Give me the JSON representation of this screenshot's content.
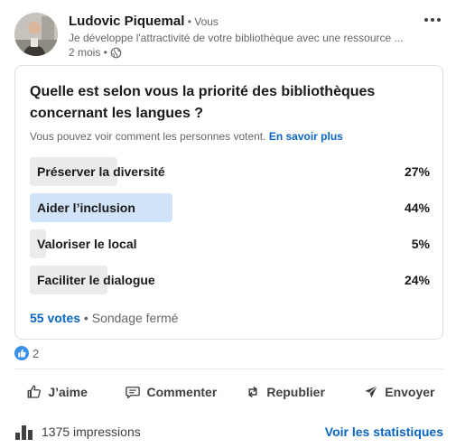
{
  "author": {
    "name": "Ludovic Piquemal",
    "badge": " • Vous",
    "headline": "Je développe l'attractivité de votre bibliothèque avec une ressource ...",
    "time": "2 mois •"
  },
  "poll": {
    "question": "Quelle est selon vous la priorité des bibliothèques concernant les langues ?",
    "note": "Vous pouvez voir comment les personnes votent.",
    "note_link": "En savoir plus",
    "options": [
      {
        "label": "Préserver la diversité",
        "percent_text": "27%",
        "percent": 27
      },
      {
        "label": "Aider l’inclusion",
        "percent_text": "44%",
        "percent": 44
      },
      {
        "label": "Valoriser le local",
        "percent_text": "5%",
        "percent": 5
      },
      {
        "label": "Faciliter le dialogue",
        "percent_text": "24%",
        "percent": 24
      }
    ],
    "votes": "55 votes",
    "status": " • Sondage fermé"
  },
  "reactions": {
    "count": "2",
    "icon": "like-icon"
  },
  "actions": {
    "like": "J’aime",
    "comment": "Commenter",
    "repost": "Republier",
    "send": "Envoyer"
  },
  "stats": {
    "impressions": "1375 impressions",
    "link": "Voir les statistiques"
  },
  "colors": {
    "accent": "#0a66c2",
    "winner_bar": "#d0e3f8",
    "bar": "#ebebeb"
  }
}
